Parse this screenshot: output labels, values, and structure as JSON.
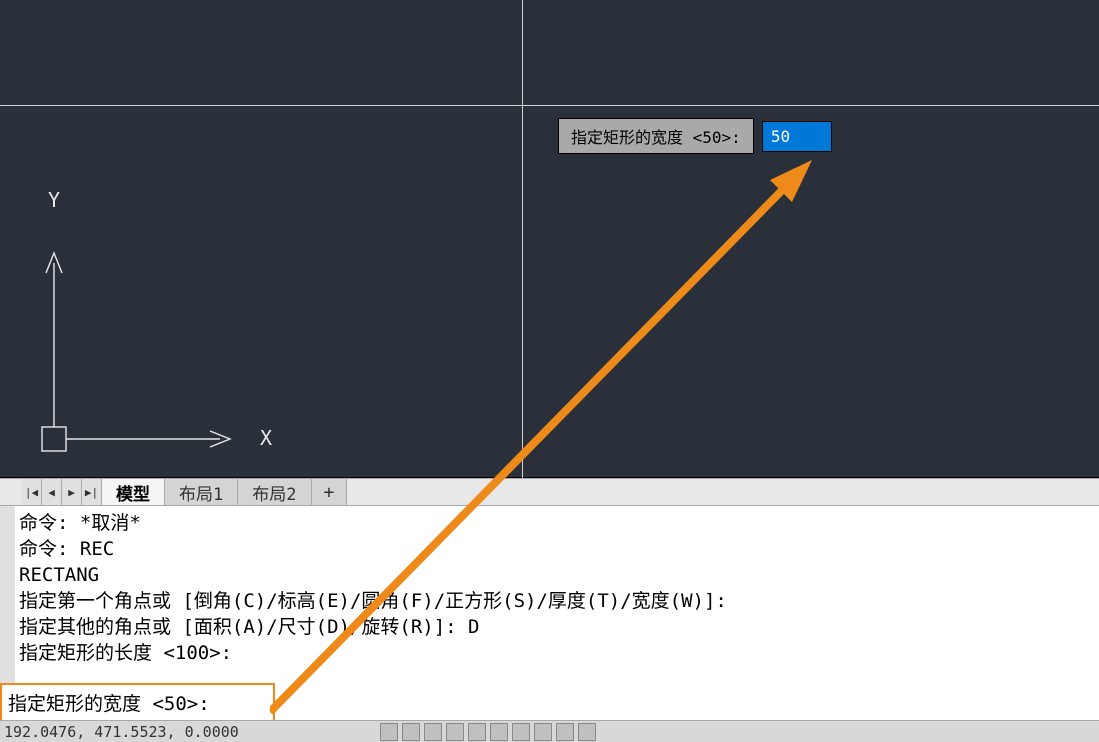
{
  "dynamic_input": {
    "label": "指定矩形的宽度 <50>:",
    "value": "50"
  },
  "ucs": {
    "x_label": "X",
    "y_label": "Y"
  },
  "tabs": {
    "items": [
      {
        "label": "模型",
        "active": true
      },
      {
        "label": "布局1",
        "active": false
      },
      {
        "label": "布局2",
        "active": false
      }
    ],
    "add": "+"
  },
  "tab_nav": {
    "first": "|◀",
    "prev": "◀",
    "next": "▶",
    "last": "▶|"
  },
  "history": {
    "lines": [
      "命令: *取消*",
      "命令: REC",
      "RECTANG",
      "指定第一个角点或 [倒角(C)/标高(E)/圆角(F)/正方形(S)/厚度(T)/宽度(W)]:",
      "指定其他的角点或 [面积(A)/尺寸(D)/旋转(R)]: D",
      "指定矩形的长度 <100>:"
    ]
  },
  "command_line": {
    "prompt": "指定矩形的宽度 <50>:"
  },
  "status": {
    "coords": "192.0476, 471.5523, 0.0000"
  },
  "history_resize": "«"
}
